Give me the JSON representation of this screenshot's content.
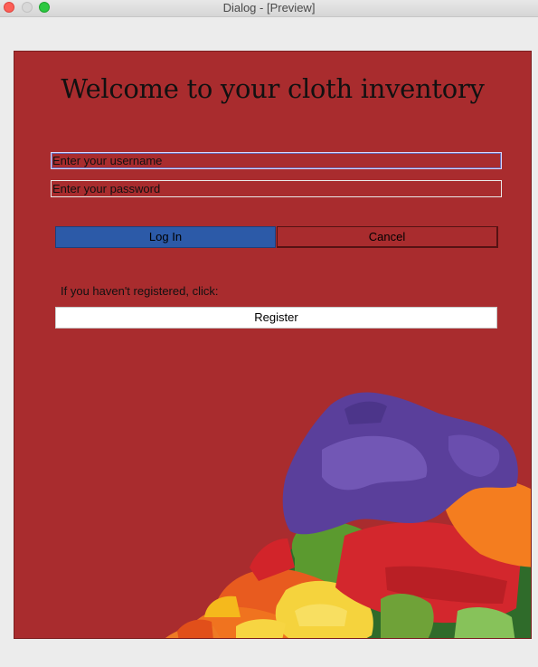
{
  "window": {
    "title": "Dialog - [Preview]"
  },
  "main": {
    "heading": "Welcome to your cloth inventory",
    "username_placeholder": "Enter your username",
    "password_placeholder": "Enter your password",
    "login_label": "Log In",
    "cancel_label": "Cancel",
    "register_prompt": "If you haven't registered, click:",
    "register_label": "Register"
  },
  "colors": {
    "panel_background": "#a92c2e",
    "login_button": "#2c5aa8",
    "register_button": "#ffffff"
  },
  "icons": {
    "close": "close-icon",
    "minimize": "minimize-icon",
    "maximize": "maximize-icon"
  }
}
